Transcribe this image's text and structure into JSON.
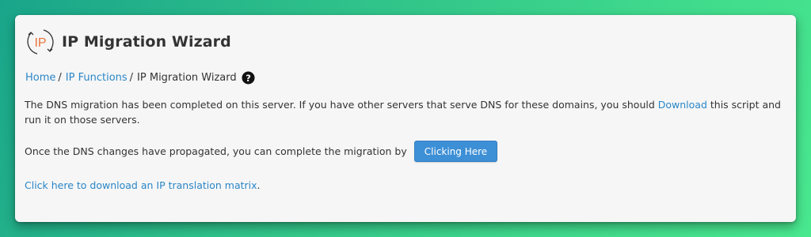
{
  "header": {
    "logo_text": "IP",
    "title": "IP Migration Wizard"
  },
  "breadcrumb": {
    "items": [
      {
        "label": "Home",
        "separator": "/"
      },
      {
        "label": "IP Functions",
        "separator": "/"
      },
      {
        "label": "IP Migration Wizard"
      }
    ],
    "help_icon": "question-circle-icon"
  },
  "content": {
    "para1_before": "The DNS migration has been completed on this server. If you have other servers that serve DNS for these domains, you should ",
    "para1_link": "Download",
    "para1_after": " this script and run it on those servers.",
    "para2_text": "Once the DNS changes have propagated, you can complete the migration by",
    "complete_button": "Clicking Here",
    "matrix_link": "Click here to download an IP translation matrix",
    "matrix_link_suffix": "."
  },
  "colors": {
    "link": "#2a86c8",
    "button": "#3d8fd6",
    "logo_accent": "#e8743b"
  }
}
